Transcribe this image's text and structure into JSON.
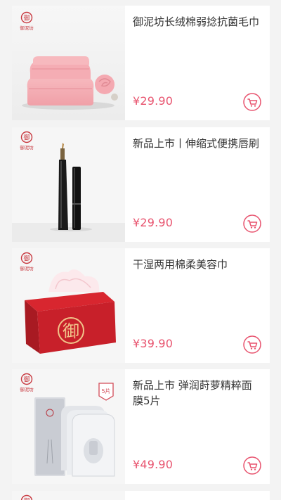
{
  "theme": {
    "accent": "#e8546f",
    "brand_red": "#c8383f"
  },
  "brand": {
    "logo_text": "御泥坊"
  },
  "products": [
    {
      "title": "御泥坊长绒棉弱捻抗菌毛巾",
      "price": "¥29.90",
      "image_icon": "towel-image"
    },
    {
      "title": "新品上市丨伸缩式便携唇刷",
      "price": "¥29.90",
      "image_icon": "lip-brush-image"
    },
    {
      "title": "干湿两用棉柔美容巾",
      "price": "¥39.90",
      "image_icon": "tissue-box-image"
    },
    {
      "title": "新品上市 弹润莳萝精粹面膜5片",
      "price": "¥49.90",
      "image_icon": "face-mask-image",
      "badge": "5片"
    }
  ]
}
